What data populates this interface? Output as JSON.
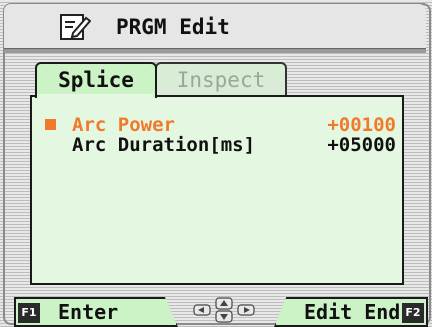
{
  "window": {
    "title": "PRGM Edit"
  },
  "tabs": [
    {
      "label": "Splice",
      "active": true
    },
    {
      "label": "Inspect",
      "active": false
    }
  ],
  "params": [
    {
      "label": "Arc Power",
      "value": "+00100",
      "selected": true
    },
    {
      "label": "Arc Duration[ms]",
      "value": "+05000",
      "selected": false
    }
  ],
  "footer": {
    "f1_badge": "F1",
    "f1_label": "Enter",
    "f2_badge": "F2",
    "f2_label": "Edit End"
  },
  "colors": {
    "accent_orange": "#f07a2a",
    "panel_green": "#e4f8e1",
    "tab_green": "#cbf3c5"
  },
  "icons": {
    "title": "edit-document-icon",
    "nav": "direction-pad-icon"
  }
}
